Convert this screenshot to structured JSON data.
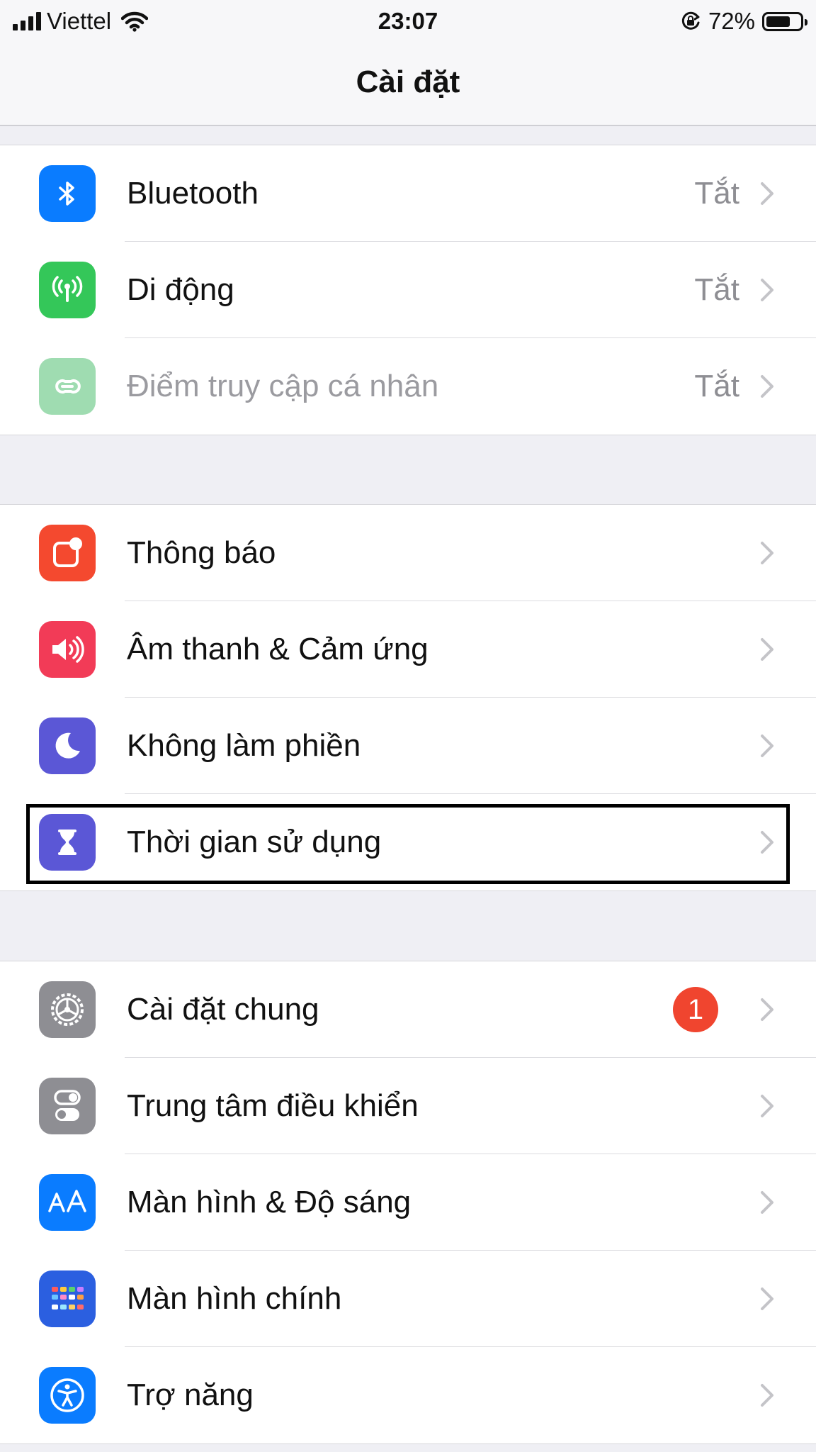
{
  "status_bar": {
    "carrier": "Viettel",
    "time": "23:07",
    "battery": "72%",
    "battery_level": 0.72,
    "icons": [
      "signal-icon",
      "wifi-icon",
      "orientation-lock-icon",
      "battery-icon"
    ]
  },
  "nav": {
    "title": "Cài đặt"
  },
  "groups": [
    {
      "rows": [
        {
          "label": "Bluetooth",
          "value": "Tắt",
          "icon": "bluetooth-icon",
          "color": "#0a7cff"
        },
        {
          "label": "Di động",
          "value": "Tắt",
          "icon": "cellular-antenna-icon",
          "color": "#34c759"
        },
        {
          "label": "Điểm truy cập cá nhân",
          "value": "Tắt",
          "icon": "personal-hotspot-icon",
          "color": "#9fdcb1",
          "dimmed": true
        }
      ]
    },
    {
      "rows": [
        {
          "label": "Thông báo",
          "icon": "notifications-icon",
          "color": "#f4492f"
        },
        {
          "label": "Âm thanh & Cảm ứng",
          "icon": "speaker-icon",
          "color": "#f23b57"
        },
        {
          "label": "Không làm phiền",
          "icon": "moon-icon",
          "color": "#5b57d6"
        },
        {
          "label": "Thời gian sử dụng",
          "icon": "hourglass-icon",
          "color": "#5b57d6",
          "highlighted": true
        }
      ]
    },
    {
      "rows": [
        {
          "label": "Cài đặt chung",
          "badge": "1",
          "icon": "gear-icon",
          "color": "#8e8e93"
        },
        {
          "label": "Trung tâm điều khiển",
          "icon": "toggle-switches-icon",
          "color": "#8e8e93"
        },
        {
          "label": "Màn hình & Độ sáng",
          "icon": "text-size-aa-icon",
          "color": "#0a7cff"
        },
        {
          "label": "Màn hình chính",
          "icon": "home-screen-grid-icon",
          "color": "#2b5fe0"
        },
        {
          "label": "Trợ năng",
          "icon": "accessibility-icon",
          "color": "#0a7cff"
        }
      ]
    }
  ]
}
